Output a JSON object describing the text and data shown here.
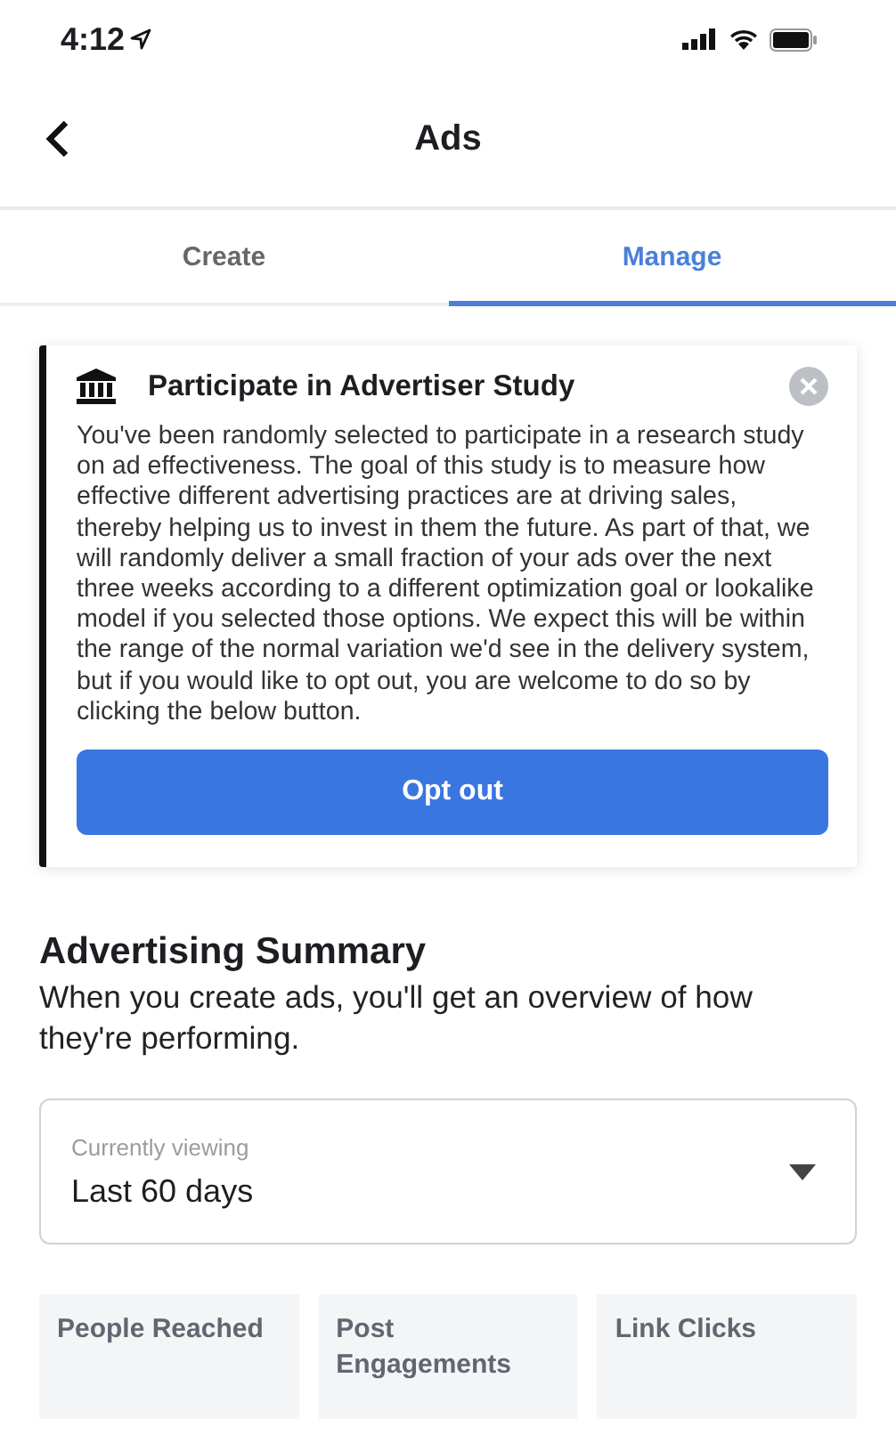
{
  "status_bar": {
    "time": "4:12"
  },
  "nav": {
    "title": "Ads"
  },
  "tabs": [
    {
      "label": "Create",
      "selected": false
    },
    {
      "label": "Manage",
      "selected": true
    }
  ],
  "study_card": {
    "title": "Participate in Advertiser Study",
    "body": "You've been randomly selected to participate in a research study on ad effectiveness. The goal of this study is to measure how effective different advertising practices are at driving sales, thereby helping us to invest in them the future. As part of that, we will randomly deliver a small fraction of your ads over the next three weeks according to a different optimization goal or lookalike model if you selected those options. We expect this will be within the range of the normal variation we'd see in the delivery system, but if you would like to opt out, you are welcome to do so by clicking the below button.",
    "button": "Opt out"
  },
  "summary": {
    "title": "Advertising Summary",
    "description": "When you create ads, you'll get an overview of how they're performing.",
    "dropdown": {
      "label": "Currently viewing",
      "value": "Last 60 days"
    },
    "stats": [
      {
        "label": "People Reached"
      },
      {
        "label": "Post Engagements"
      },
      {
        "label": "Link Clicks"
      }
    ]
  }
}
